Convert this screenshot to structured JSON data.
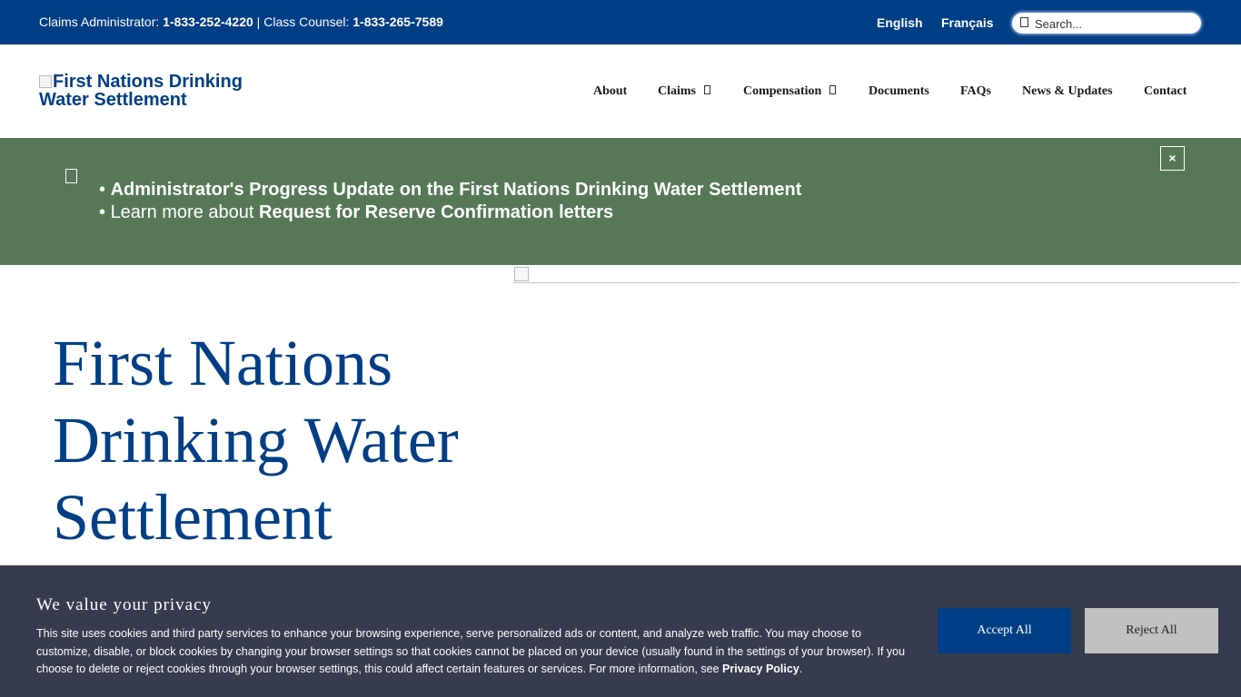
{
  "topbar": {
    "claims_label": "Claims Administrator:",
    "claims_phone": "1-833-252-4220",
    "separator": " | ",
    "counsel_label": "Class Counsel:",
    "counsel_phone": "1-833-265-7589",
    "lang_english": "English",
    "lang_french": "Français",
    "search_placeholder": "Search..."
  },
  "header": {
    "logo_alt_line1": "First Nations Drinking",
    "logo_alt_line2": "Water Settlement",
    "nav": {
      "about": "About",
      "claims": "Claims",
      "compensation": "Compensation",
      "documents": "Documents",
      "faqs": "FAQs",
      "news": "News & Updates",
      "contact": "Contact"
    }
  },
  "notice": {
    "bullet": "• ",
    "link1": "Administrator's Progress Update on the First Nations Drinking Water Settlement",
    "line2_prefix": "Learn more about ",
    "link2": "Request for Reserve Confirmation letters",
    "close_label": "×"
  },
  "hero": {
    "title_line1": "First Nations",
    "title_line2": "Drinking Water",
    "title_line3": "Settlement"
  },
  "cookie": {
    "title": "We value your privacy",
    "body": "This site uses cookies and third party services to enhance your browsing experience, serve personalized ads or content, and analyze web traffic. You may choose to customize, disable, or block cookies by changing your browser settings so that cookies cannot be placed on your device (usually found in the settings of your browser). If you choose to delete or reject cookies through your browser settings, this could affect certain features or services. For more information, see ",
    "policy_link": "Privacy Policy",
    "end": ".",
    "accept": "Accept All",
    "reject": "Reject All"
  },
  "colors": {
    "primary_blue": "#003e85",
    "notice_green": "#567857",
    "cookie_bg": "#373b4e",
    "reject_gray": "#c1c1c1"
  }
}
